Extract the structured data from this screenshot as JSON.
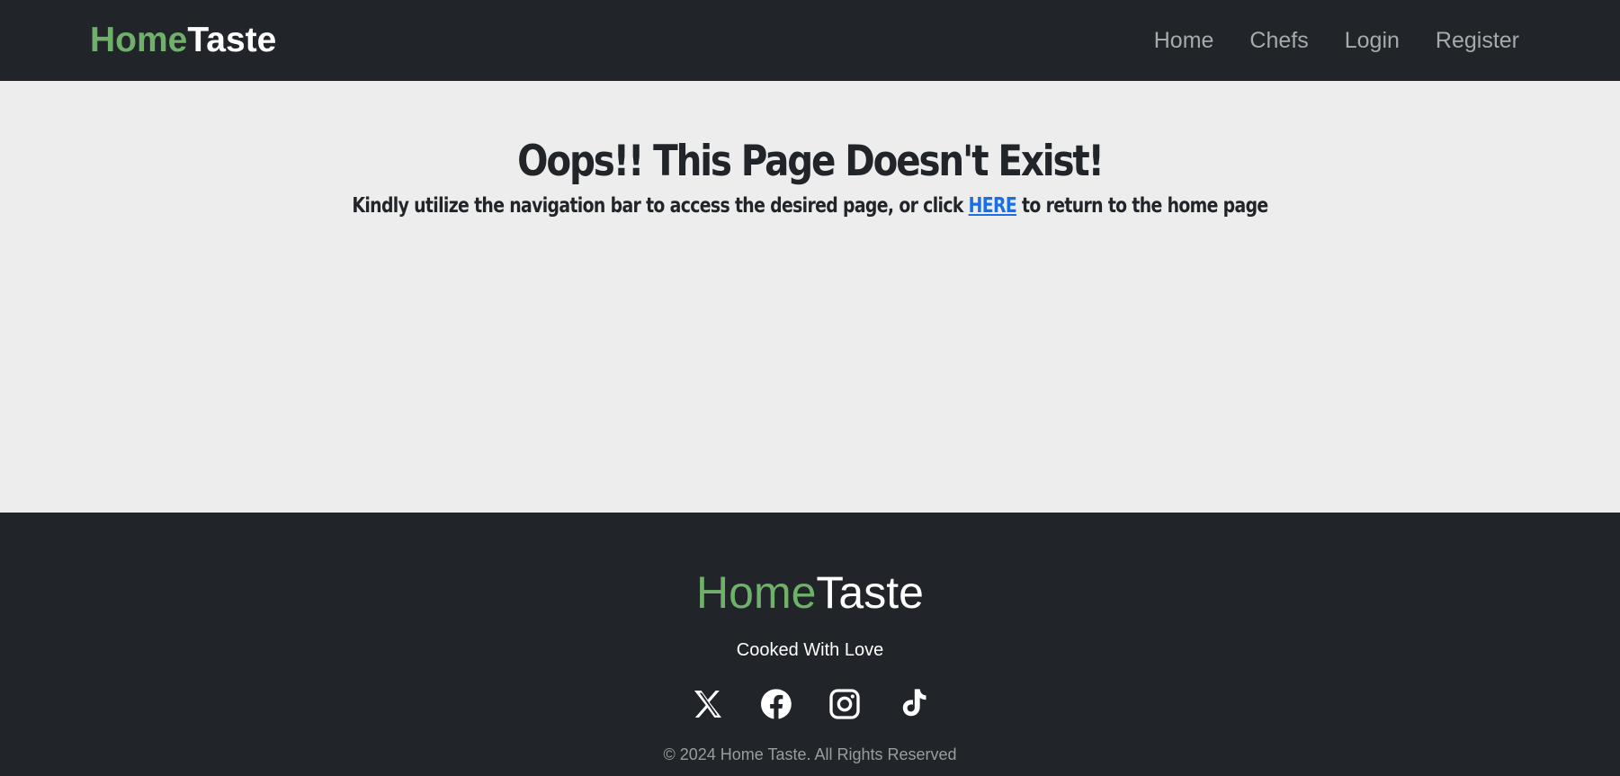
{
  "navbar": {
    "brand_part1": "Home",
    "brand_part2": "Taste",
    "links": [
      {
        "label": "Home"
      },
      {
        "label": "Chefs"
      },
      {
        "label": "Login"
      },
      {
        "label": "Register"
      }
    ]
  },
  "main": {
    "heading": "Oops!! This Page Doesn't Exist!",
    "sub_before": "Kindly utilize the navigation bar to access the desired page, or click ",
    "sub_link": "HERE",
    "sub_after": " to return to the home page"
  },
  "footer": {
    "brand_part1": "Home",
    "brand_part2": "Taste",
    "tagline": "Cooked With Love",
    "socials": [
      {
        "icon": "x-icon"
      },
      {
        "icon": "facebook-icon"
      },
      {
        "icon": "instagram-icon"
      },
      {
        "icon": "tiktok-icon"
      }
    ],
    "copyright": "© 2024 Home Taste. All Rights Reserved"
  },
  "colors": {
    "brand_green": "#6fb06a",
    "dark_bg": "#212529",
    "main_bg": "#ededed",
    "link_blue": "#1a6ee6"
  }
}
